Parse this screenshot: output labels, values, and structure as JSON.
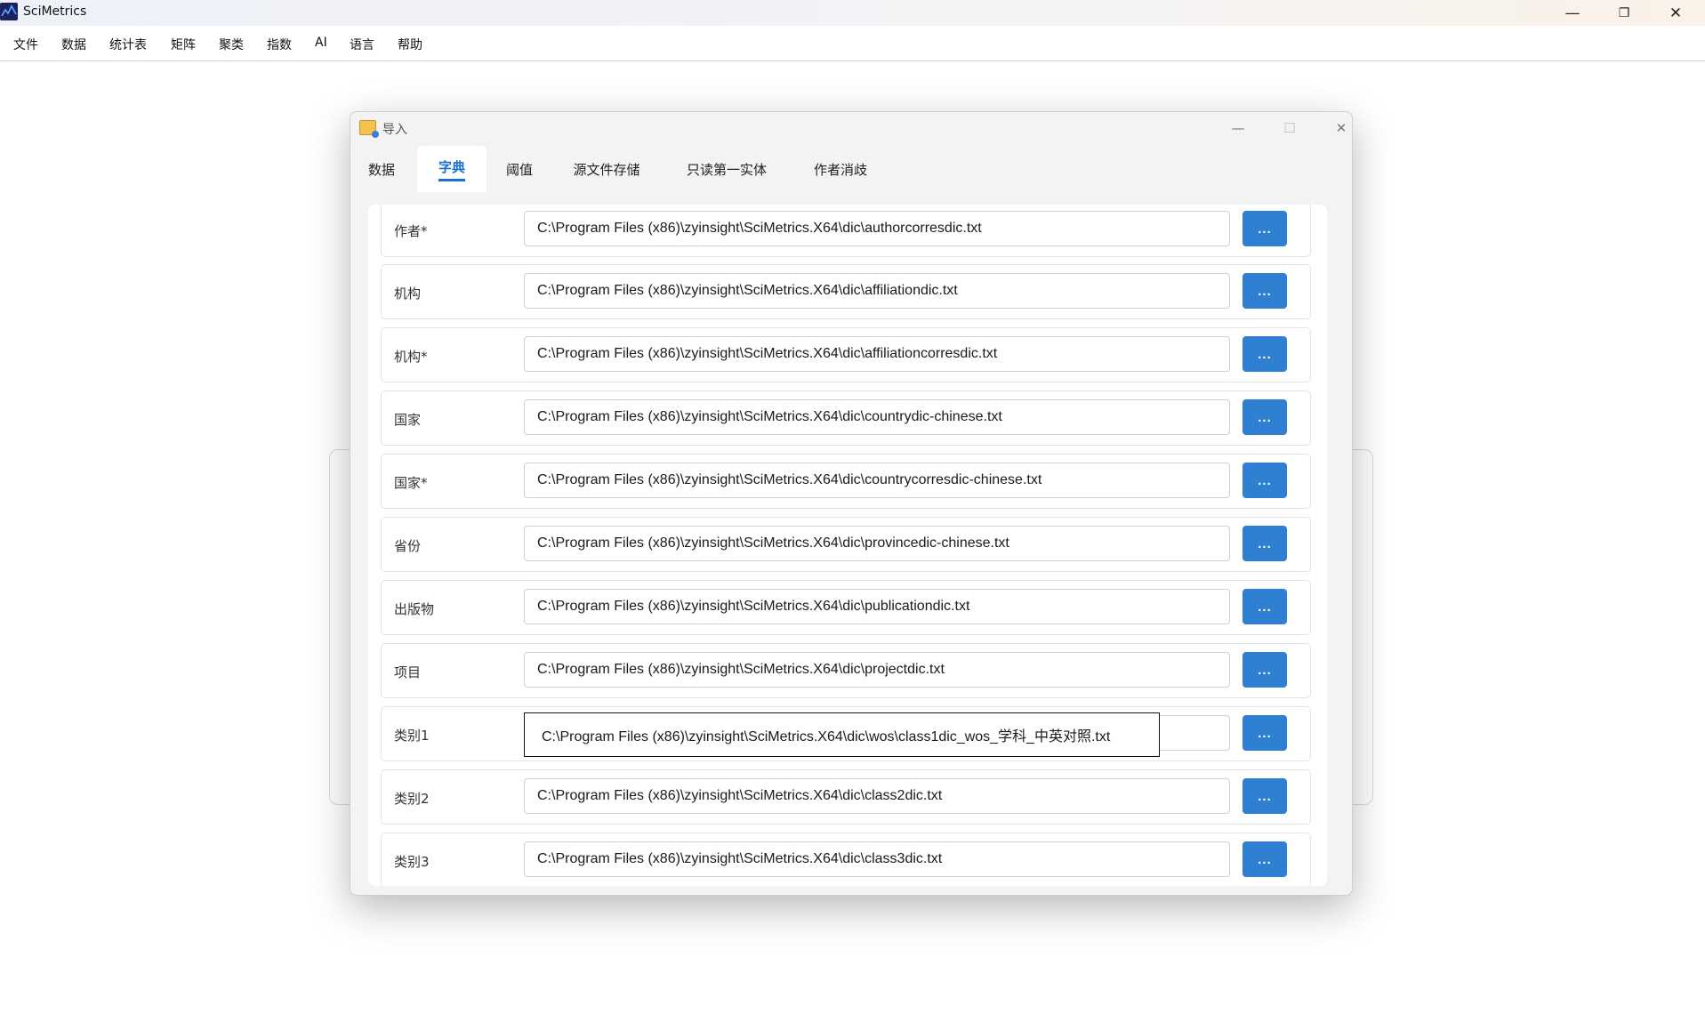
{
  "app": {
    "title": "SciMetrics",
    "controls": {
      "minimize": "—",
      "restore": "❐",
      "close": "✕"
    }
  },
  "menu": {
    "items": [
      "文件",
      "数据",
      "统计表",
      "矩阵",
      "聚类",
      "指数",
      "AI",
      "语言",
      "帮助"
    ]
  },
  "dialog": {
    "title": "导入",
    "controls": {
      "minimize": "—",
      "maximize": "☐",
      "close": "✕"
    },
    "tabs": [
      {
        "label": "数据"
      },
      {
        "label": "字典",
        "active": true
      },
      {
        "label": "阈值"
      },
      {
        "label": "源文件存储"
      },
      {
        "label": "只读第一实体"
      },
      {
        "label": "作者消歧"
      }
    ],
    "browse_label": "...",
    "rows": [
      {
        "label": "作者*",
        "value": "C:\\Program Files (x86)\\zyinsight\\SciMetrics.X64\\dic\\authorcorresdic.txt"
      },
      {
        "label": "机构",
        "value": "C:\\Program Files (x86)\\zyinsight\\SciMetrics.X64\\dic\\affiliationdic.txt"
      },
      {
        "label": "机构*",
        "value": "C:\\Program Files (x86)\\zyinsight\\SciMetrics.X64\\dic\\affiliationcorresdic.txt"
      },
      {
        "label": "国家",
        "value": "C:\\Program Files (x86)\\zyinsight\\SciMetrics.X64\\dic\\countrydic-chinese.txt"
      },
      {
        "label": "国家*",
        "value": "C:\\Program Files (x86)\\zyinsight\\SciMetrics.X64\\dic\\countrycorresdic-chinese.txt"
      },
      {
        "label": "省份",
        "value": "C:\\Program Files (x86)\\zyinsight\\SciMetrics.X64\\dic\\provincedic-chinese.txt"
      },
      {
        "label": "出版物",
        "value": "C:\\Program Files (x86)\\zyinsight\\SciMetrics.X64\\dic\\publicationdic.txt"
      },
      {
        "label": "项目",
        "value": "C:\\Program Files (x86)\\zyinsight\\SciMetrics.X64\\dic\\projectdic.txt"
      },
      {
        "label": "类别1",
        "value": "C:\\Program Files (x86)\\zyinsight\\SciMetrics.X64\\dic\\wos\\class1dic_wos_学科_中英对照.txt",
        "focused": true
      },
      {
        "label": "类别2",
        "value": "C:\\Program Files (x86)\\zyinsight\\SciMetrics.X64\\dic\\class2dic.txt"
      },
      {
        "label": "类别3",
        "value": "C:\\Program Files (x86)\\zyinsight\\SciMetrics.X64\\dic\\class3dic.txt"
      }
    ]
  }
}
